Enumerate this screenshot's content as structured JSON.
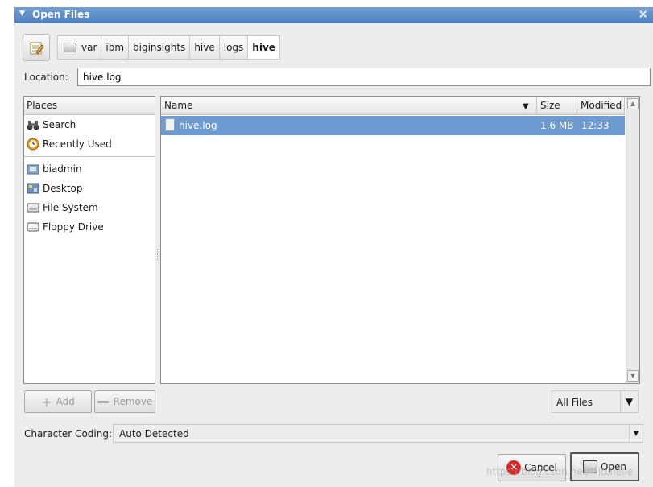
{
  "window": {
    "title": "Open Files"
  },
  "path_bar": {
    "crumbs": [
      {
        "label": "var"
      },
      {
        "label": "ibm"
      },
      {
        "label": "biginsights"
      },
      {
        "label": "hive"
      },
      {
        "label": "logs"
      },
      {
        "label": "hive"
      }
    ]
  },
  "location": {
    "label": "Location:",
    "value": "hive.log"
  },
  "places": {
    "header": "Places",
    "items": [
      {
        "label": "Search",
        "icon": "binoculars-icon"
      },
      {
        "label": "Recently Used",
        "icon": "clock-icon"
      },
      {
        "label": "biadmin",
        "icon": "home-folder-icon"
      },
      {
        "label": "Desktop",
        "icon": "desktop-icon"
      },
      {
        "label": "File System",
        "icon": "harddisk-icon"
      },
      {
        "label": "Floppy Drive",
        "icon": "floppy-icon"
      }
    ],
    "add_label": "Add",
    "remove_label": "Remove"
  },
  "files": {
    "columns": {
      "name": "Name",
      "size": "Size",
      "modified": "Modified"
    },
    "rows": [
      {
        "name": "hive.log",
        "size": "1.6 MB",
        "modified": "12:33"
      }
    ]
  },
  "filter": {
    "selected": "All Files"
  },
  "character_coding": {
    "label": "Character Coding:",
    "value": "Auto Detected"
  },
  "buttons": {
    "cancel": "Cancel",
    "open": "Open"
  },
  "watermark": "https://blog.csdn.net/Mitchelle"
}
